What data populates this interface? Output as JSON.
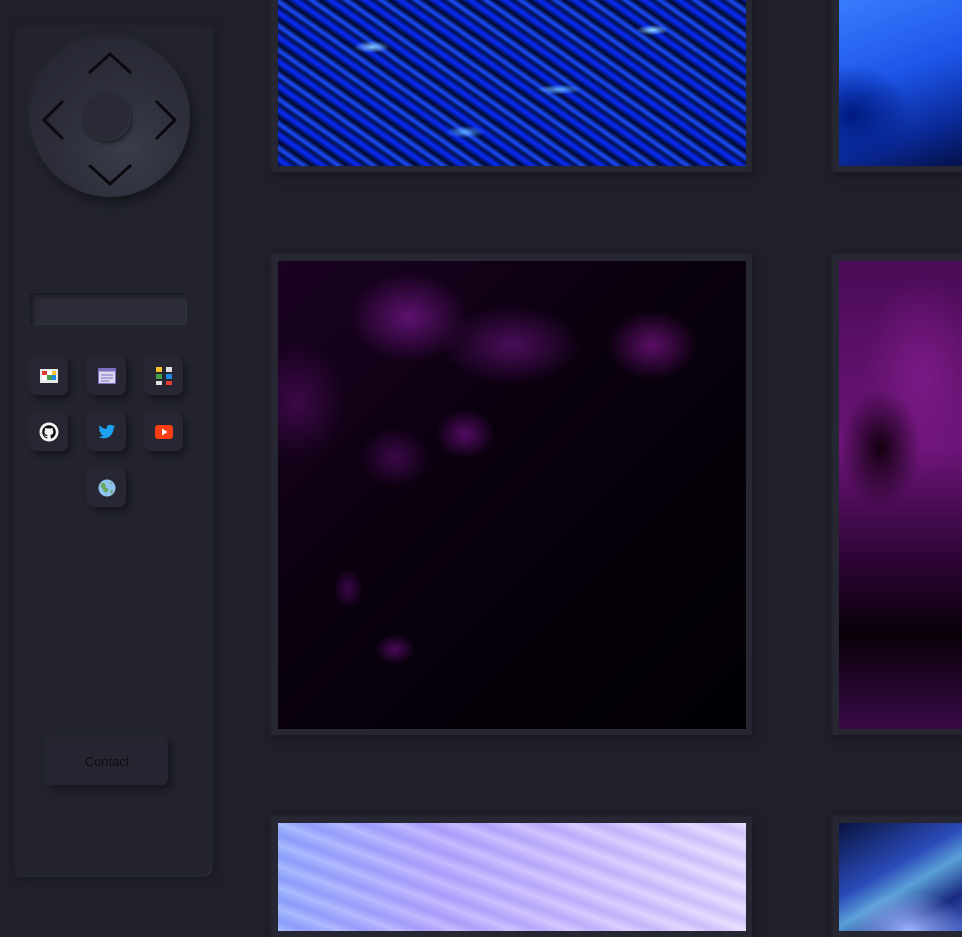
{
  "sidebar": {
    "search": {
      "value": "",
      "placeholder": ""
    },
    "contact_label": "Contact"
  },
  "nav_icons": [
    {
      "name": "checkered-app-icon"
    },
    {
      "name": "browser-window-icon"
    },
    {
      "name": "grid-app-icon"
    },
    {
      "name": "github-icon"
    },
    {
      "name": "twitter-icon"
    },
    {
      "name": "youtube-icon"
    },
    {
      "name": "globe-icon"
    }
  ],
  "colors": {
    "background": "#202029",
    "panel": "#22232d",
    "twitter": "#1da1f2",
    "youtube": "#ff3d12"
  }
}
